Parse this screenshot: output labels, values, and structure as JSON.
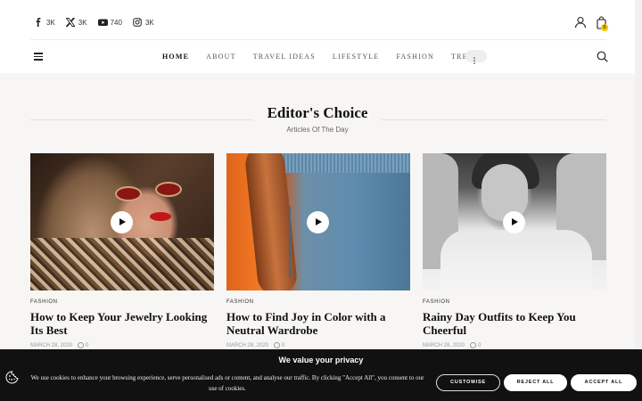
{
  "social": [
    {
      "icon": "facebook-icon",
      "count": "3K"
    },
    {
      "icon": "x-twitter-icon",
      "count": "3K"
    },
    {
      "icon": "youtube-icon",
      "count": "740"
    },
    {
      "icon": "instagram-icon",
      "count": "3K"
    }
  ],
  "cart": {
    "count": "0"
  },
  "nav": {
    "items": [
      "HOME",
      "ABOUT",
      "TRAVEL IDEAS",
      "LIFESTYLE",
      "FASHION",
      "TRENDS"
    ],
    "active": "HOME"
  },
  "section": {
    "title": "Editor's Choice",
    "subtitle": "Articles Of The Day"
  },
  "articles": [
    {
      "category": "FASHION",
      "title": "How to Keep Your Jewelry Looking Its Best",
      "date": "MARCH 28, 2020",
      "comments": "0"
    },
    {
      "category": "FASHION",
      "title": "How to Find Joy in Color with a Neutral Wardrobe",
      "date": "MARCH 28, 2020",
      "comments": "0"
    },
    {
      "category": "FASHION",
      "title": "Rainy Day Outfits to Keep You Cheerful",
      "date": "MARCH 28, 2020",
      "comments": "0"
    }
  ],
  "cookie": {
    "title": "We value your privacy",
    "text": "We use cookies to enhance your browsing experience, serve personalised ads or content, and analyse our traffic. By clicking \"Accept All\", you consent to our use of cookies.",
    "customise": "CUSTOMISE",
    "reject": "REJECT ALL",
    "accept": "ACCEPT ALL"
  },
  "colors": {
    "accent_badge": "#f2c400",
    "banner_bg": "#111111",
    "section_bg": "#f7f6f4"
  }
}
